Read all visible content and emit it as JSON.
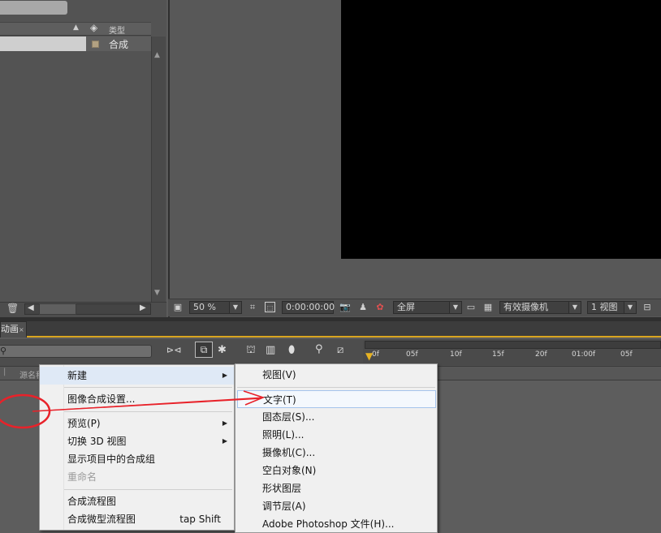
{
  "project_panel": {
    "column_type_label": "类型",
    "item_type_value": "合成"
  },
  "viewer": {
    "zoom": "50 %",
    "timecode": "0:00:00:00",
    "resolution": "全屏",
    "camera": "有效摄像机",
    "views": "1 视图"
  },
  "timeline": {
    "tab_label": "动画",
    "tab_close": "×",
    "column_source_name": "源名称",
    "ruler_ticks": [
      "0f",
      "05f",
      "10f",
      "15f",
      "20f",
      "01:00f",
      "05f"
    ]
  },
  "context_menu": {
    "items": [
      {
        "label": "新建",
        "submenu": true,
        "shortcut": "",
        "disabled": false
      },
      {
        "label": "图像合成设置...",
        "submenu": false,
        "shortcut": "",
        "disabled": false
      },
      {
        "label": "预览(P)",
        "submenu": true,
        "shortcut": "",
        "disabled": false
      },
      {
        "label": "切换 3D 视图",
        "submenu": true,
        "shortcut": "",
        "disabled": false
      },
      {
        "label": "显示项目中的合成组",
        "submenu": false,
        "shortcut": "",
        "disabled": false
      },
      {
        "label": "重命名",
        "submenu": false,
        "shortcut": "",
        "disabled": true
      },
      {
        "label": "合成流程图",
        "submenu": false,
        "shortcut": "",
        "disabled": false
      },
      {
        "label": "合成微型流程图",
        "submenu": false,
        "shortcut": "tap Shift",
        "disabled": false
      }
    ]
  },
  "new_submenu": {
    "items": [
      {
        "label": "视图(V)"
      },
      {
        "label": "文字(T)"
      },
      {
        "label": "固态层(S)..."
      },
      {
        "label": "照明(L)..."
      },
      {
        "label": "摄像机(C)..."
      },
      {
        "label": "空白对象(N)"
      },
      {
        "label": "形状图层"
      },
      {
        "label": "调节层(A)"
      },
      {
        "label": "Adobe Photoshop 文件(H)..."
      }
    ]
  },
  "colors": {
    "annotation_red": "#e8222a",
    "playhead": "#e7b322",
    "tab_underline": "#d9a520"
  }
}
